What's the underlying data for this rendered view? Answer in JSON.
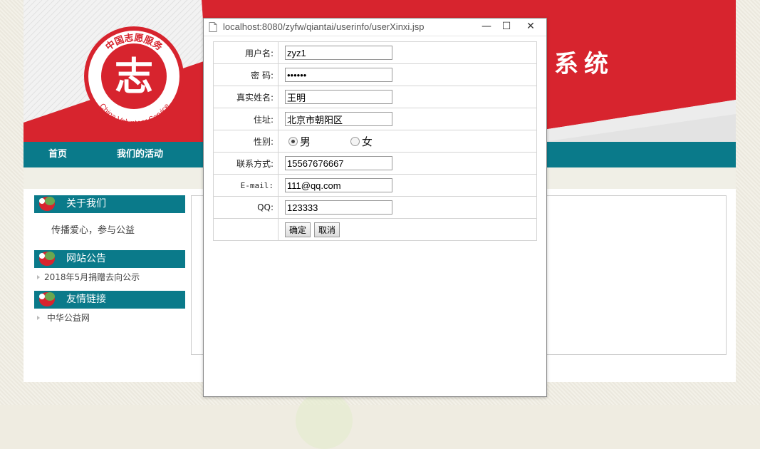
{
  "popup": {
    "url": "localhost:8080/zyfw/qiantai/userinfo/userXinxi.jsp",
    "window_buttons": {
      "minimize": "—",
      "maximize": "☐",
      "close": "✕"
    },
    "form": {
      "username_label": "用户名:",
      "username_value": "zyz1",
      "password_label": "密 码:",
      "password_value": "123456",
      "realname_label": "真实姓名:",
      "realname_value": "王明",
      "address_label": "住址:",
      "address_value": "北京市朝阳区",
      "gender_label": "性别:",
      "gender_male": "男",
      "gender_female": "女",
      "gender_selected": "男",
      "phone_label": "联系方式:",
      "phone_value": "15567676667",
      "email_label": "E-mail:",
      "email_value": "111@qq.com",
      "qq_label": "QQ:",
      "qq_value": "123333",
      "confirm_label": "确定",
      "cancel_label": "取消"
    }
  },
  "site": {
    "banner_title": "系统",
    "logo_text_top": "中国志愿服务",
    "logo_text_bottom": "China Volunteer Service",
    "nav": [
      "首页",
      "我们的活动"
    ],
    "sidebar": {
      "about_title": "关于我们",
      "about_text": "传播爱心，参与公益",
      "notice_title": "网站公告",
      "notice_items": [
        "2018年5月捐赠去向公示"
      ],
      "links_title": "友情链接",
      "links_items": [
        "中华公益网"
      ]
    },
    "colors": {
      "red": "#d7242e",
      "teal": "#0a7a8a"
    }
  }
}
